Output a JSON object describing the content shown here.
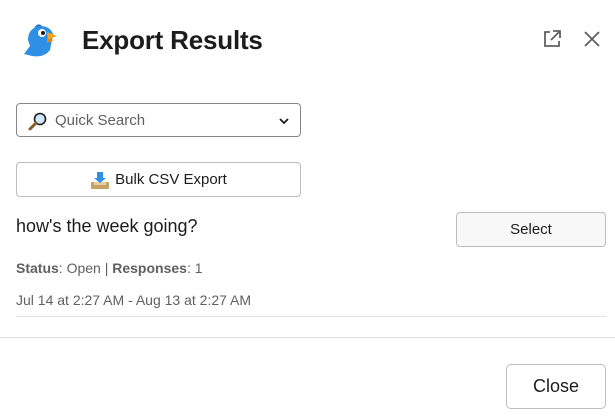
{
  "header": {
    "title": "Export Results",
    "icons": {
      "logo": "bird-logo-icon",
      "popout": "open-in-new-window-icon",
      "close": "close-icon"
    }
  },
  "search": {
    "placeholder": "Quick Search",
    "icon": "magnifying-glass-icon"
  },
  "bulk_export": {
    "label": "Bulk CSV Export",
    "icon": "download-tray-icon"
  },
  "survey": {
    "title": "how's the week going?",
    "select_label": "Select",
    "status_label": "Status",
    "status_value": "Open",
    "separator": "|",
    "responses_label": "Responses",
    "responses_value": "1",
    "date_range": "Jul 14 at 2:27 AM - Aug 13 at 2:27 AM"
  },
  "footer": {
    "close_label": "Close"
  },
  "colors": {
    "logo_blue": "#2e8fe6",
    "logo_orange": "#f5a623",
    "text_primary": "#1d1c1d",
    "text_secondary": "#616061"
  }
}
